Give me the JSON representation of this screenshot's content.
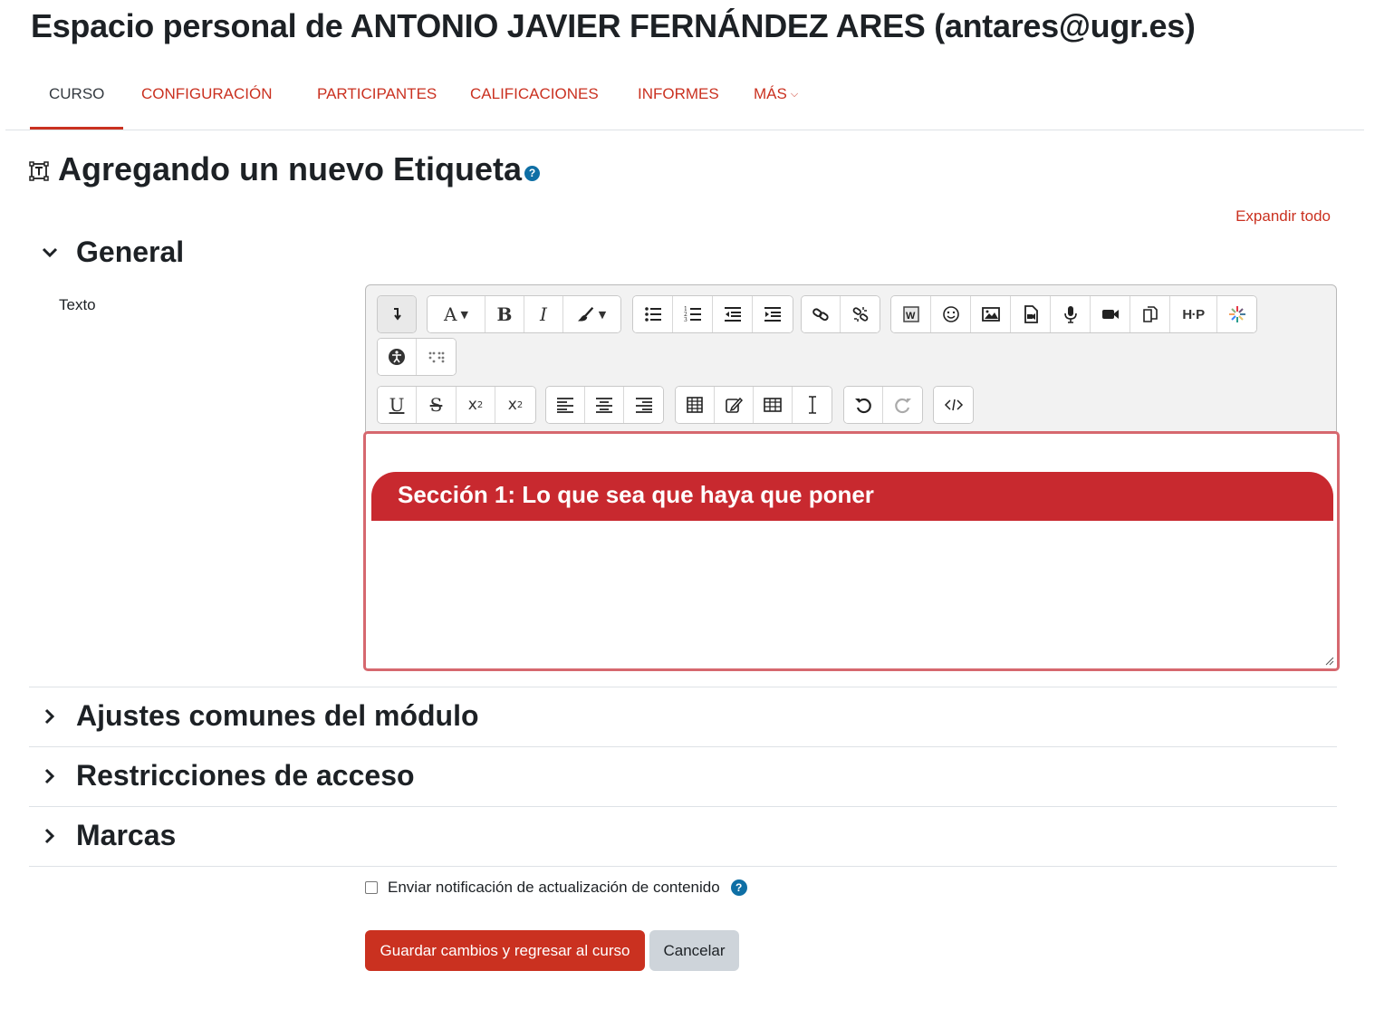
{
  "header": {
    "prefix": "Espacio personal de ",
    "name": "ANTONIO JAVIER FERNÁNDEZ ARES",
    "email": "(antares@ugr.es)"
  },
  "nav": {
    "tabs": [
      {
        "label": "CURSO",
        "active": true
      },
      {
        "label": "CONFIGURACIÓN"
      },
      {
        "label": "PARTICIPANTES"
      },
      {
        "label": "CALIFICACIONES"
      },
      {
        "label": "INFORMES"
      },
      {
        "label": "MÁS"
      }
    ]
  },
  "page": {
    "title": "Agregando un nuevo Etiqueta",
    "help_icon": "question-circle-icon",
    "expand_all": "Expandir todo"
  },
  "sections": {
    "general": "General",
    "common": "Ajustes comunes del módulo",
    "restrictions": "Restricciones de acceso",
    "tags": "Marcas"
  },
  "form": {
    "text_label": "Texto",
    "editor_content": {
      "banner_text": "Sección 1: Lo que sea que haya que poner",
      "banner_color": "#c8292f"
    },
    "notify_label": "Enviar notificación de actualización de contenido",
    "notify_checked": false,
    "save_button": "Guardar cambios y regresar al curso",
    "cancel_button": "Cancelar"
  },
  "toolbar": {
    "row1": [
      "collapse-icon",
      "font-color-icon",
      "bold-icon",
      "italic-icon",
      "paintbrush-icon",
      "unordered-list-icon",
      "ordered-list-icon",
      "outdent-icon",
      "indent-icon",
      "link-icon",
      "unlink-icon",
      "word-import-icon",
      "emoticon-icon",
      "image-icon",
      "media-icon",
      "record-audio-icon",
      "record-video-icon",
      "manage-files-icon",
      "h5p-icon",
      "generico-icon"
    ],
    "row2": [
      "accessibility-checker-icon",
      "screenreader-helper-icon"
    ],
    "row3": [
      "underline-icon",
      "strikethrough-icon",
      "subscript-icon",
      "superscript-icon",
      "align-left-icon",
      "align-center-icon",
      "align-right-icon",
      "table-icon",
      "edit-table-icon",
      "table-view-icon",
      "text-cursor-icon",
      "undo-icon",
      "redo-icon",
      "html-icon"
    ]
  },
  "colors": {
    "brand_red": "#ca3120",
    "text_dark": "#1d2125",
    "help_blue": "#0f6fa5"
  }
}
